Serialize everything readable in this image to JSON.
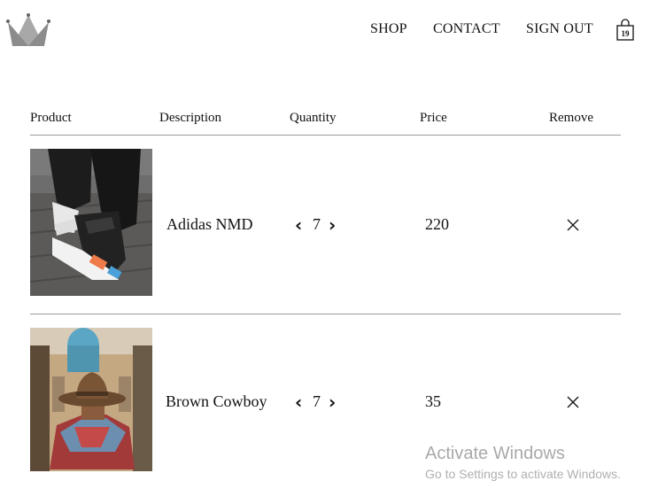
{
  "nav": {
    "shop": "SHOP",
    "contact": "CONTACT",
    "sign_out": "SIGN OUT",
    "cart_count": "19"
  },
  "icons": {
    "logo": "crown-icon",
    "cart": "shopping-bag-icon",
    "decrease": "chevron-left-icon",
    "increase": "chevron-right-icon",
    "remove": "close-icon"
  },
  "table": {
    "headers": [
      "Product",
      "Description",
      "Quantity",
      "Price",
      "Remove"
    ],
    "rows": [
      {
        "name": "Adidas NMD",
        "quantity": "7",
        "price": "220"
      },
      {
        "name": "Brown Cowboy",
        "quantity": "7",
        "price": "35"
      }
    ]
  },
  "watermark": {
    "title": "Activate Windows",
    "subtitle": "Go to Settings to activate Windows."
  }
}
